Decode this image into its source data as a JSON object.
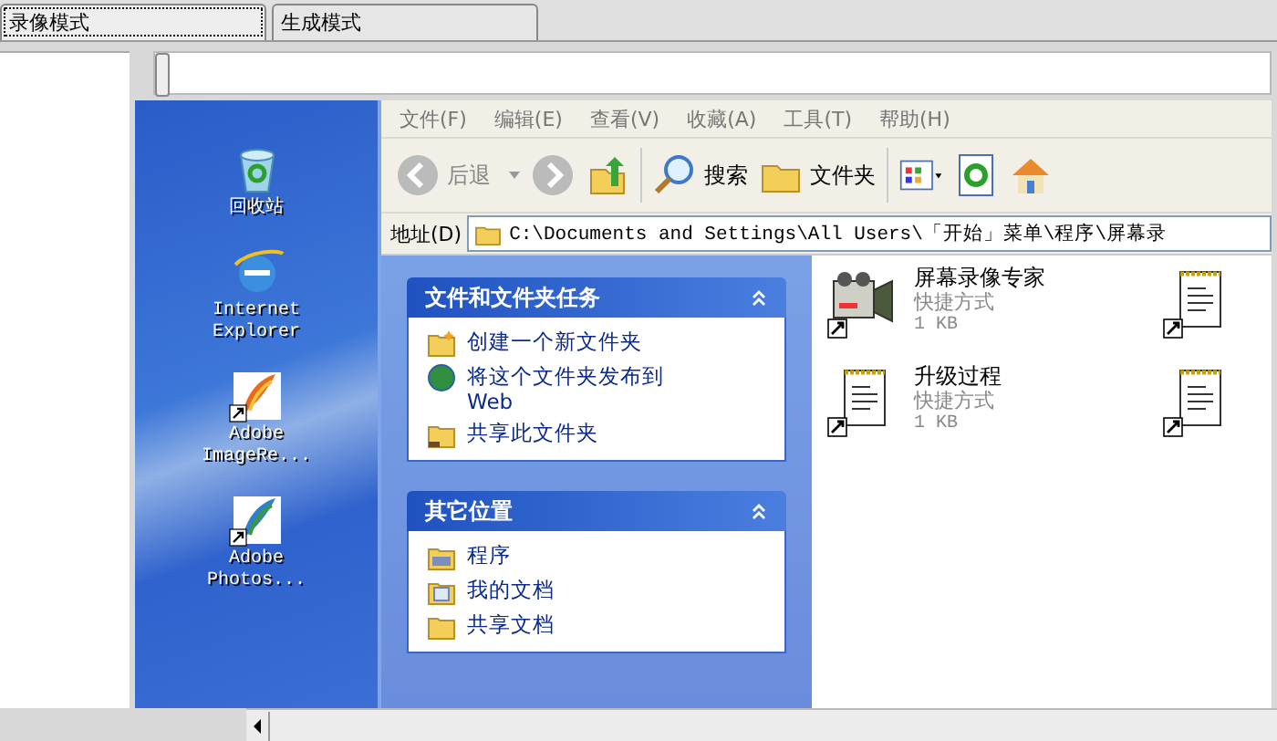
{
  "tabs": [
    {
      "label": "录像模式",
      "selected": true
    },
    {
      "label": "生成模式",
      "selected": false
    }
  ],
  "slider": {
    "level": 0
  },
  "desktop_icons": [
    {
      "label": "回收站",
      "kind": "recycle",
      "shortcut": false
    },
    {
      "label": "Internet Explorer",
      "kind": "ie",
      "shortcut": false
    },
    {
      "label": "Adobe ImageRe...",
      "kind": "feather-orange",
      "shortcut": true
    },
    {
      "label": "Adobe Photos...",
      "kind": "feather-blue",
      "shortcut": true
    }
  ],
  "explorer": {
    "menu": [
      "文件(F)",
      "编辑(E)",
      "查看(V)",
      "收藏(A)",
      "工具(T)",
      "帮助(H)"
    ],
    "toolbar": {
      "back": "后退",
      "search": "搜索",
      "folders": "文件夹"
    },
    "address": {
      "label": "地址(D)",
      "value": "C:\\Documents and Settings\\All Users\\「开始」菜单\\程序\\屏幕录"
    },
    "panels": [
      {
        "title": "文件和文件夹任务",
        "expanded": true,
        "items": [
          {
            "label": "创建一个新文件夹",
            "kind": "new-folder"
          },
          {
            "label": "将这个文件夹发布到 Web",
            "kind": "globe"
          },
          {
            "label": "共享此文件夹",
            "kind": "share-folder"
          }
        ]
      },
      {
        "title": "其它位置",
        "expanded": true,
        "items": [
          {
            "label": "程序",
            "kind": "programs"
          },
          {
            "label": "我的文档",
            "kind": "documents"
          },
          {
            "label": "共享文档",
            "kind": "folder"
          }
        ]
      }
    ],
    "files": [
      {
        "name": "屏幕录像专家",
        "type": "快捷方式",
        "size": "1 KB",
        "kind": "camera"
      },
      {
        "kind": "notepad"
      },
      {
        "name": "升级过程",
        "type": "快捷方式",
        "size": "1 KB",
        "kind": "notepad"
      },
      {
        "kind": "notepad"
      }
    ]
  }
}
